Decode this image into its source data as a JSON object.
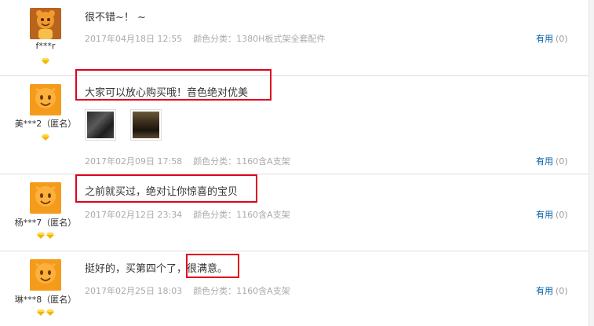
{
  "reviews": [
    {
      "user": "f***r",
      "comment": "很不错~！ ~",
      "date": "2017年04月18日 12:55",
      "color_category": "颜色分类：1380H板式架全套配件",
      "useful_label": "有用",
      "useful_count": "(0)",
      "badges": 1,
      "photo_avatar": true
    },
    {
      "user": "美***2（匿名）",
      "comment": "大家可以放心购买哦！音色绝对优美",
      "date": "2017年02月09日 17:58",
      "color_category": "颜色分类：1160含A支架",
      "useful_label": "有用",
      "useful_count": "(0)",
      "badges": 1,
      "photo_avatar": false
    },
    {
      "user": "杨***7（匿名）",
      "comment": "之前就买过，绝对让你惊喜的宝贝",
      "date": "2017年02月12日 23:34",
      "color_category": "颜色分类：1160含A支架",
      "useful_label": "有用",
      "useful_count": "(0)",
      "badges": 2,
      "photo_avatar": false
    },
    {
      "user": "琳***8（匿名）",
      "comment_a": "挺好的，买第四个了，",
      "comment_b": "很满意。",
      "date": "2017年02月25日 18:03",
      "color_category": "颜色分类：1160含A支架",
      "useful_label": "有用",
      "useful_count": "(0)",
      "badges": 2,
      "photo_avatar": false
    }
  ],
  "colors": {
    "highlight_box": "#e0001b",
    "useful_link": "#005ea7",
    "meta_text": "#aaaaaa",
    "avatar_orange": "#f59b1c",
    "badge_gold": "#f5b400"
  }
}
